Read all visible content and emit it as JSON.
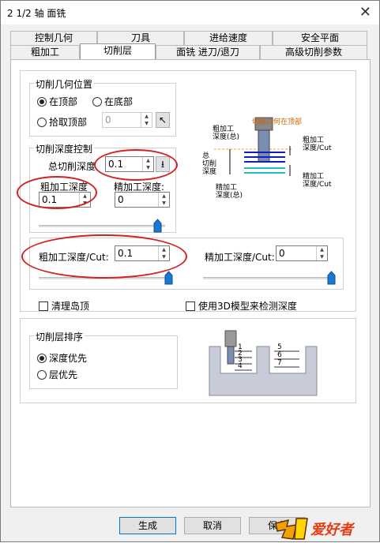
{
  "window": {
    "title": "2 1/2 轴 面铣",
    "close": "✕"
  },
  "tabs_row1": [
    "控制几何",
    "刀具",
    "进给速度",
    "安全平面"
  ],
  "tabs_row2": [
    "粗加工",
    "切削层",
    "面铣 进刀/退刀",
    "高级切削参数"
  ],
  "geometry_group": {
    "legend": "切削几何位置",
    "opt_top": "在顶部",
    "opt_bottom": "在底部",
    "opt_pick": "拾取顶部",
    "pick_value": "0"
  },
  "depth_group": {
    "legend": "切削深度控制",
    "total_label": "总切削深度",
    "total_value": "0.1",
    "rough_label": "粗加工深度",
    "rough_value": "0.1",
    "finish_label": "精加工深度:",
    "finish_value": "0"
  },
  "per_cut": {
    "rough_label": "粗加工深度/Cut:",
    "rough_value": "0.1",
    "finish_label": "精加工深度/Cut:",
    "finish_value": "0"
  },
  "diagram1": {
    "top_label": "切削几何在顶部",
    "rough_total": "粗加工\n深度(总)",
    "total_depth": "总\n切削\n深度",
    "finish_total": "精加工\n深度(总)",
    "rough_cut": "粗加工\n深度/Cut",
    "finish_cut": "精加工\n深度/Cut"
  },
  "clear_islands": "清理岛顶",
  "use_3d": "使用3D模型来检测深度",
  "order_group": {
    "legend": "切削层排序",
    "opt_depth": "深度优先",
    "opt_layer": "层优先"
  },
  "diagram2": {
    "left_numbers": [
      "1",
      "2",
      "3",
      "4"
    ],
    "right_numbers": [
      "5",
      "6",
      "7"
    ]
  },
  "buttons": {
    "ok": "生成",
    "cancel": "取消",
    "save": "保存"
  },
  "watermark": "爱好者"
}
